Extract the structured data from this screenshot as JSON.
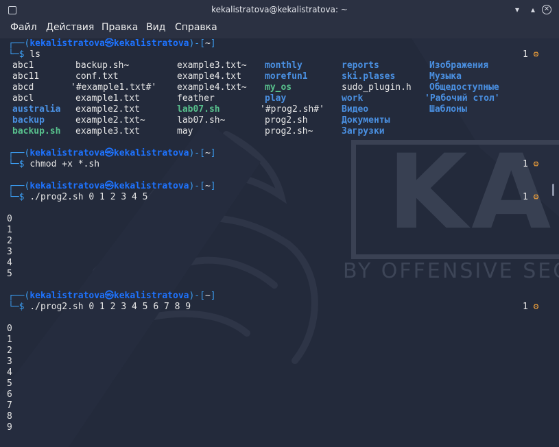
{
  "window": {
    "title": "kekalistratova@kekalistratova: ~",
    "controls": [
      "minimize-icon",
      "maximize-icon",
      "close-icon"
    ]
  },
  "menu": [
    "Файл",
    "Действия",
    "Правка",
    "Вид",
    "Справка"
  ],
  "background_logo": {
    "text_big": "KAL",
    "text_small": "BY OFFENSIVE SECU"
  },
  "terminal": {
    "prompt": {
      "open": "┌──(",
      "user": "kekalistratova",
      "at": "㉿",
      "host": "kekalistratova",
      "close": ")-[",
      "dir": "~",
      "end": "]",
      "prefix": "└─",
      "symbol": "$"
    },
    "commands": [
      {
        "cmd": "ls",
        "status": "1"
      },
      {
        "cmd": "chmod +x *.sh",
        "status": "1"
      },
      {
        "cmd": "./prog2.sh 0 1 2 3 4 5",
        "status": "1"
      },
      {
        "cmd": "./prog2.sh 0 1 2 3 4 5 6 7 8 9",
        "status": "1"
      }
    ],
    "ls_columns": [
      [
        {
          "name": "abc1",
          "kind": "file"
        },
        {
          "name": "abc11",
          "kind": "file"
        },
        {
          "name": "abcd",
          "kind": "file"
        },
        {
          "name": "abcl",
          "kind": "file"
        },
        {
          "name": "australia",
          "kind": "dir"
        },
        {
          "name": "backup",
          "kind": "dir"
        },
        {
          "name": "backup.sh",
          "kind": "exec"
        }
      ],
      [
        {
          "name": "backup.sh~",
          "kind": "file"
        },
        {
          "name": "conf.txt",
          "kind": "file"
        },
        {
          "name": "'#example1.txt#'",
          "kind": "file"
        },
        {
          "name": "example1.txt",
          "kind": "file"
        },
        {
          "name": "example2.txt",
          "kind": "file"
        },
        {
          "name": "example2.txt~",
          "kind": "file"
        },
        {
          "name": "example3.txt",
          "kind": "file"
        }
      ],
      [
        {
          "name": "example3.txt~",
          "kind": "file"
        },
        {
          "name": "example4.txt",
          "kind": "file"
        },
        {
          "name": "example4.txt~",
          "kind": "file"
        },
        {
          "name": "feather",
          "kind": "file"
        },
        {
          "name": "lab07.sh",
          "kind": "exec"
        },
        {
          "name": "lab07.sh~",
          "kind": "file"
        },
        {
          "name": "may",
          "kind": "file"
        }
      ],
      [
        {
          "name": "monthly",
          "kind": "dir"
        },
        {
          "name": "morefun1",
          "kind": "dir"
        },
        {
          "name": "my_os",
          "kind": "exec"
        },
        {
          "name": "play",
          "kind": "dir"
        },
        {
          "name": "'#prog2.sh#'",
          "kind": "file"
        },
        {
          "name": "prog2.sh",
          "kind": "file"
        },
        {
          "name": "prog2.sh~",
          "kind": "file"
        }
      ],
      [
        {
          "name": "reports",
          "kind": "dir"
        },
        {
          "name": "ski.plases",
          "kind": "dir"
        },
        {
          "name": "sudo_plugin.h",
          "kind": "file"
        },
        {
          "name": "work",
          "kind": "dir"
        },
        {
          "name": "Видео",
          "kind": "dir"
        },
        {
          "name": "Документы",
          "kind": "dir"
        },
        {
          "name": "Загрузки",
          "kind": "dir"
        }
      ],
      [
        {
          "name": "Изображения",
          "kind": "dir"
        },
        {
          "name": "Музыка",
          "kind": "dir"
        },
        {
          "name": "Общедоступные",
          "kind": "dir"
        },
        {
          "name": "'Рабочий стол'",
          "kind": "dir"
        },
        {
          "name": "Шаблоны",
          "kind": "dir"
        }
      ]
    ],
    "output1": [
      "0",
      "1",
      "2",
      "3",
      "4",
      "5"
    ],
    "output2": [
      "0",
      "1",
      "2",
      "3",
      "4",
      "5",
      "6",
      "7",
      "8",
      "9"
    ]
  },
  "colors": {
    "prompt_frame": "#3b9cf0",
    "user": "#1e73ff",
    "dir": "#4a90e2",
    "exec": "#58c18d",
    "gear": "#f0a03a",
    "background": "#232a3b"
  }
}
